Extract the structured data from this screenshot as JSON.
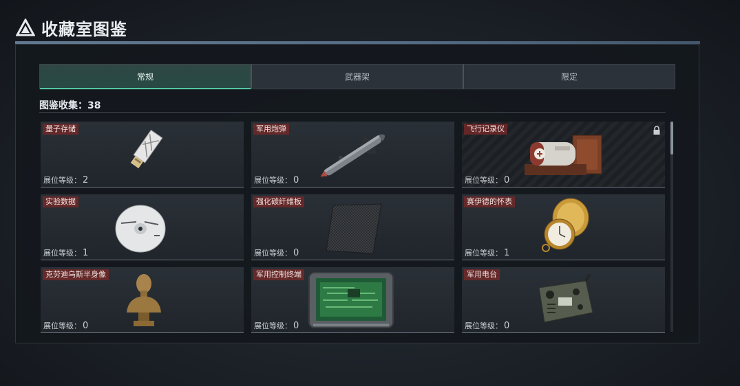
{
  "header": {
    "title": "收藏室图鉴"
  },
  "tabs": [
    {
      "label": "常规",
      "active": true
    },
    {
      "label": "武器架",
      "active": false
    },
    {
      "label": "限定",
      "active": false
    }
  ],
  "collection": {
    "label": "图鉴收集：38"
  },
  "level_label": "展位等级：",
  "items": [
    {
      "name": "量子存储",
      "level": "2",
      "icon": "usb-drive-icon",
      "locked": false
    },
    {
      "name": "军用炮弹",
      "level": "0",
      "icon": "missile-icon",
      "locked": false
    },
    {
      "name": "飞行记录仪",
      "level": "0",
      "icon": "flight-recorder-icon",
      "locked": true
    },
    {
      "name": "实验数据",
      "level": "1",
      "icon": "disc-icon",
      "locked": false
    },
    {
      "name": "强化碳纤维板",
      "level": "0",
      "icon": "carbon-plate-icon",
      "locked": false
    },
    {
      "name": "赛伊德的怀表",
      "level": "1",
      "icon": "pocket-watch-icon",
      "locked": false
    },
    {
      "name": "克劳迪乌斯半身像",
      "level": "0",
      "icon": "bust-icon",
      "locked": false
    },
    {
      "name": "军用控制终端",
      "level": "0",
      "icon": "circuit-terminal-icon",
      "locked": false
    },
    {
      "name": "军用电台",
      "level": "0",
      "icon": "radio-icon",
      "locked": false
    }
  ],
  "colors": {
    "accent": "#54c9a2",
    "name_badge": "#702828",
    "panel": "#14181d"
  }
}
